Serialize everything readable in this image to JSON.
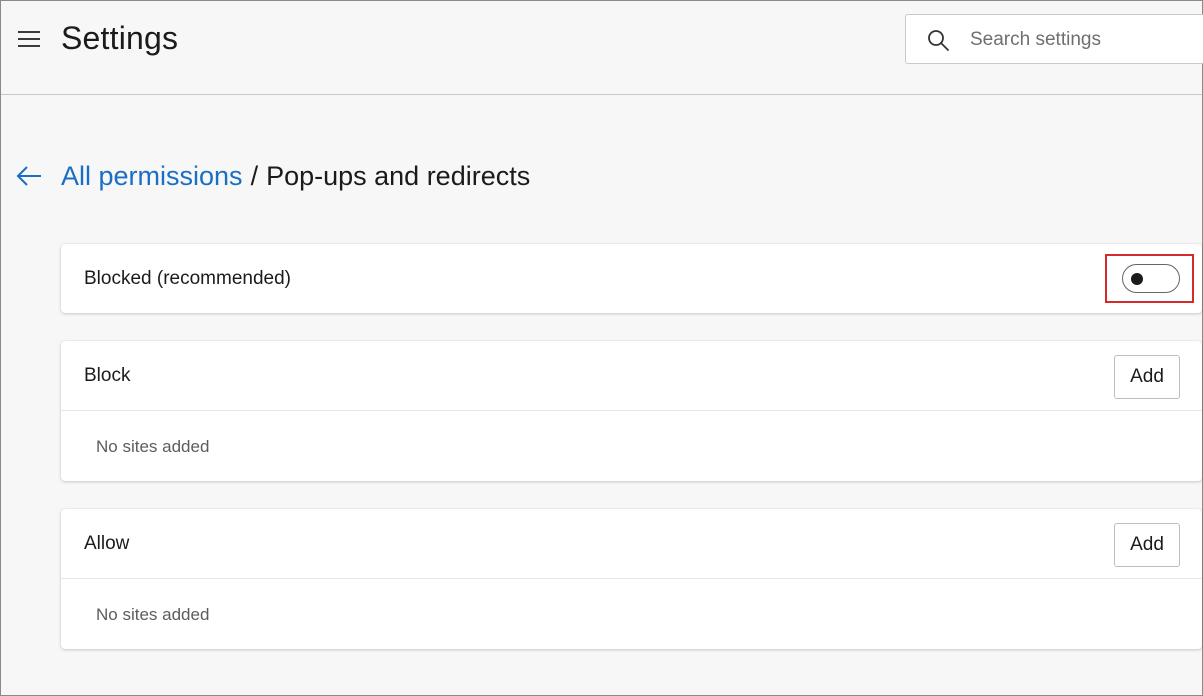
{
  "header": {
    "title": "Settings",
    "search_placeholder": "Search settings"
  },
  "breadcrumb": {
    "parent": "All permissions",
    "separator": "/",
    "current": "Pop-ups and redirects"
  },
  "blocked_row": {
    "label": "Blocked (recommended)",
    "toggle_on": false
  },
  "block_section": {
    "title": "Block",
    "add_label": "Add",
    "empty_text": "No sites added"
  },
  "allow_section": {
    "title": "Allow",
    "add_label": "Add",
    "empty_text": "No sites added"
  },
  "colors": {
    "link": "#1a6fc4",
    "highlight": "#d42a2a",
    "background": "#f7f7f7"
  }
}
